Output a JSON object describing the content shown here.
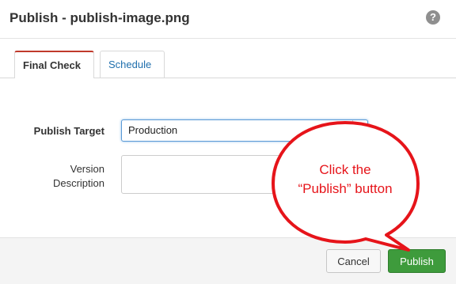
{
  "dialog": {
    "title": "Publish - publish-image.png",
    "help_icon": "question-circle-icon"
  },
  "tabs": [
    {
      "label": "Final Check",
      "active": true
    },
    {
      "label": "Schedule",
      "active": false
    }
  ],
  "form": {
    "publish_target_label": "Publish Target",
    "publish_target_value": "Production",
    "version_label_line1": "Version",
    "version_label_line2": "Description",
    "version_value": ""
  },
  "footer": {
    "cancel_label": "Cancel",
    "publish_label": "Publish"
  },
  "callout": {
    "line1": "Click the",
    "line2": "“Publish” button",
    "color": "#e6141a"
  },
  "colors": {
    "publish_button": "#3e9b3c",
    "active_tab_accent": "#c0392b",
    "tab_link": "#1f6fad"
  }
}
